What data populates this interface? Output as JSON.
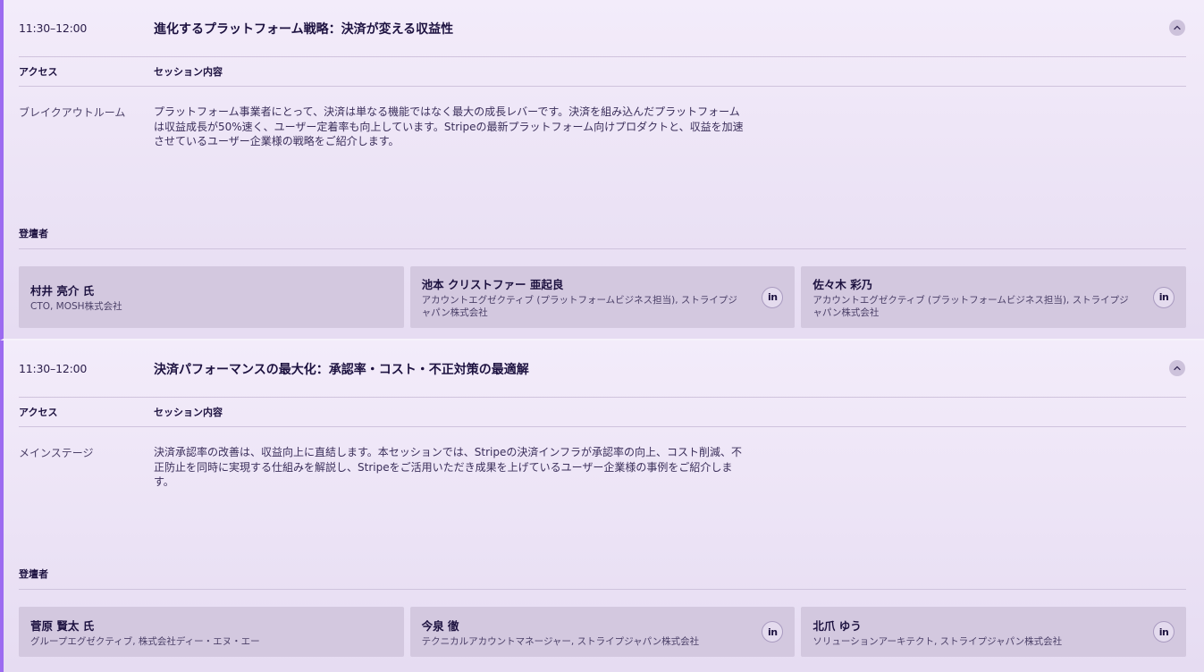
{
  "sessions": [
    {
      "time": "11:30–12:00",
      "title": "進化するプラットフォーム戦略：決済が変える収益性",
      "access_header": "アクセス",
      "content_header": "セッション内容",
      "access": "ブレイクアウトルーム",
      "description": "プラットフォーム事業者にとって、決済は単なる機能ではなく最大の成長レバーです。決済を組み込んだプラットフォームは収益成長が50%速く、ユーザー定着率も向上しています。Stripeの最新プラットフォーム向けプロダクトと、収益を加速させているユーザー企業様の戦略をご紹介します。",
      "speakers_header": "登壇者",
      "speakers": [
        {
          "name": "村井 亮介 氏",
          "role": "CTO, MOSH株式会社",
          "linkedin": ""
        },
        {
          "name": "池本 クリストファー 亜起良",
          "role": "アカウントエグゼクティブ (プラットフォームビジネス担当), ストライプジャパン株式会社",
          "linkedin": "in"
        },
        {
          "name": "佐々木 彩乃",
          "role": "アカウントエグゼクティブ (プラットフォームビジネス担当), ストライプジャパン株式会社",
          "linkedin": "in"
        }
      ]
    },
    {
      "time": "11:30–12:00",
      "title": "決済パフォーマンスの最大化：承認率・コスト・不正対策の最適解",
      "access_header": "アクセス",
      "content_header": "セッション内容",
      "access": "メインステージ",
      "description": "決済承認率の改善は、収益向上に直結します。本セッションでは、Stripeの決済インフラが承認率の向上、コスト削減、不正防止を同時に実現する仕組みを解説し、Stripeをご活用いただき成果を上げているユーザー企業様の事例をご紹介します。",
      "speakers_header": "登壇者",
      "speakers": [
        {
          "name": "菅原 賢太 氏",
          "role": "グループエグゼクティブ, 株式会社ディー・エヌ・エー",
          "linkedin": ""
        },
        {
          "name": "今泉 徹",
          "role": "テクニカルアカウントマネージャー, ストライプジャパン株式会社",
          "linkedin": "in"
        },
        {
          "name": "北爪 ゆう",
          "role": "ソリューションアーキテクト, ストライプジャパン株式会社",
          "linkedin": "in"
        }
      ]
    }
  ],
  "icons": {
    "toggle": "chevron-up-icon",
    "linkedin": "linkedin-icon"
  },
  "colors": {
    "accent": "#9c6bf0",
    "card": "#d3c8df",
    "text": "#1d1240"
  }
}
